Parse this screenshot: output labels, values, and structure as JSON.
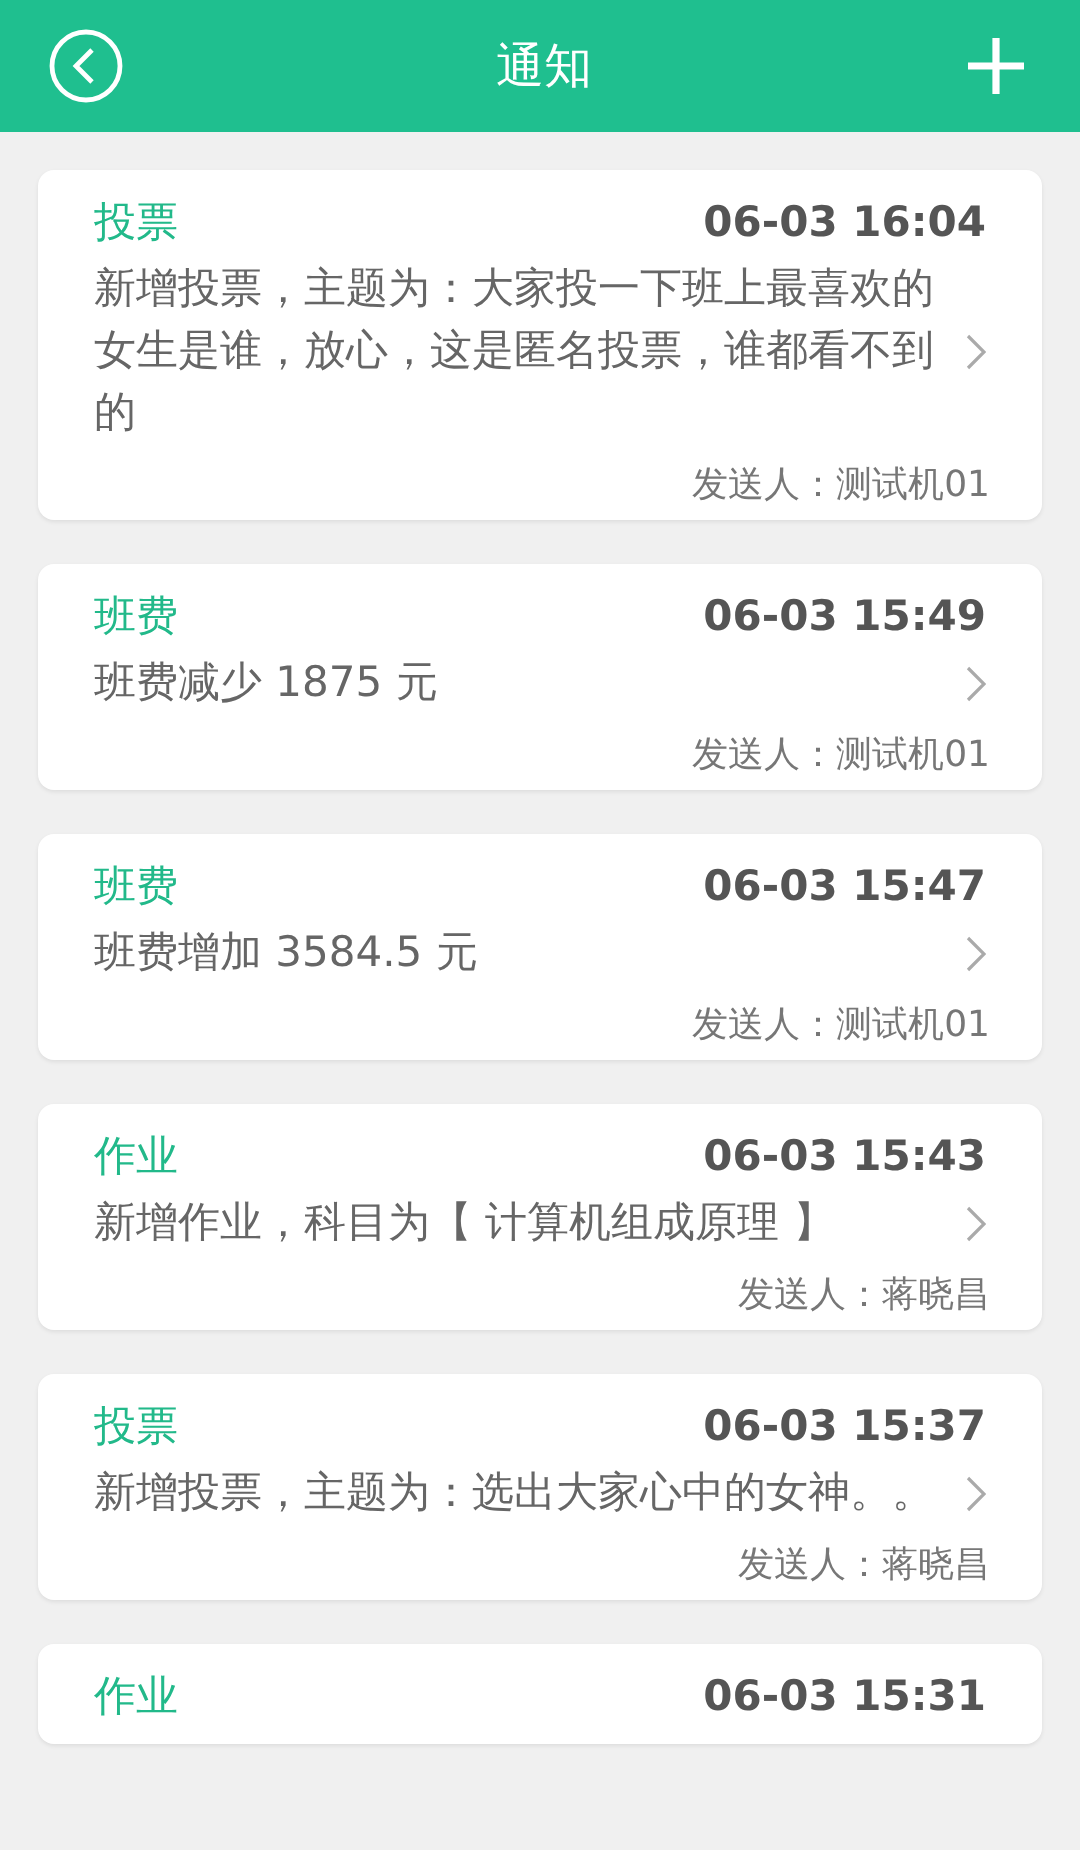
{
  "header": {
    "title": "通知"
  },
  "notices": [
    {
      "category": "投票",
      "time": "06-03 16:04",
      "message": "新增投票，主题为：大家投一下班上最喜欢的女生是谁，放心，这是匿名投票，谁都看不到的",
      "sender": "发送人：测试机01"
    },
    {
      "category": "班费",
      "time": "06-03 15:49",
      "message": "班费减少 1875 元",
      "sender": "发送人：测试机01"
    },
    {
      "category": "班费",
      "time": "06-03 15:47",
      "message": "班费增加 3584.5 元",
      "sender": "发送人：测试机01"
    },
    {
      "category": "作业",
      "time": "06-03 15:43",
      "message": "新增作业，科目为【 计算机组成原理 】",
      "sender": "发送人：蒋晓昌"
    },
    {
      "category": "投票",
      "time": "06-03 15:37",
      "message": "新增投票，主题为：选出大家心中的女神。。",
      "sender": "发送人：蒋晓昌"
    },
    {
      "category": "作业",
      "time": "06-03 15:31"
    }
  ]
}
